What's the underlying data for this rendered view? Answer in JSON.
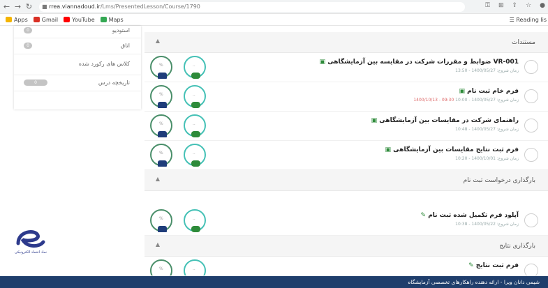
{
  "browser": {
    "url_host": "rrea.viannadoud.ir",
    "url_path": "/Lms/PresentedLesson/Course/1790",
    "bookmarks": [
      "Apps",
      "Gmail",
      "YouTube",
      "Maps"
    ],
    "reading_list": "Reading lis"
  },
  "sidebar": {
    "items": [
      {
        "label": "استوديو",
        "badge": "0"
      },
      {
        "label": "اتاق",
        "badge": "0"
      },
      {
        "label": "کلاس های رکورد شده",
        "badge": ""
      },
      {
        "label": "تاریخچه درس",
        "badge": "0"
      }
    ]
  },
  "sections": [
    {
      "title": "مستندات",
      "items": [
        {
          "title": "ضوابط و مقررات شرکت در مقایسه بین آزمایشگاهی VR-001",
          "meta": "زمان شروع: 1400/05/27 - 13:50",
          "meta_red": ""
        },
        {
          "title": "فرم خام ثبت نام",
          "meta": "زمان شروع: 1400/05/27 - 10:00",
          "meta_red": "1400/10/13 - 09:30"
        },
        {
          "title": "راهنمای شرکت در مقایسات بین آزمایشگاهی",
          "meta": "زمان شروع: 1400/05/27 - 10:48",
          "meta_red": ""
        },
        {
          "title": "فرم ثبت نتایج مقایسات بین آزمایشگاهی",
          "meta": "زمان شروع: 1400/10/01 - 10:20",
          "meta_red": ""
        }
      ]
    },
    {
      "title": "بارگذاری درخواست ثبت نام",
      "items": [
        {
          "title": "آپلود فرم تکمیل شده ثبت نام",
          "meta": "زمان شروع: 1400/05/22 - 10:38",
          "meta_red": ""
        }
      ]
    },
    {
      "title": "بارگذاری نتایج",
      "items": [
        {
          "title": "فرم ثبت نتایج",
          "meta": "",
          "meta_red": ""
        }
      ]
    }
  ],
  "logo": {
    "caption": "نماد اعتماد الکترونیکی"
  },
  "footer": {
    "text": "شیمی دانان ویرا - ارائه دهنده راهکارهای تخصصی آزمایشگاه"
  }
}
